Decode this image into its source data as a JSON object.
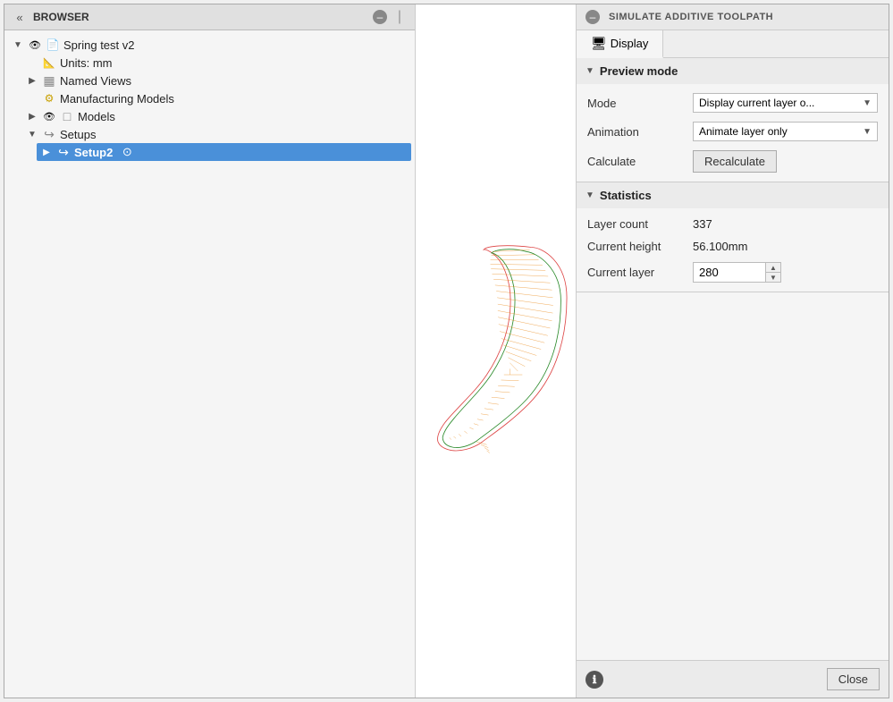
{
  "browser": {
    "title": "BROWSER",
    "header_icons": [
      "«",
      "–",
      "|"
    ],
    "tree": {
      "root": {
        "label": "Spring test v2",
        "icon": "doc",
        "expanded": true
      },
      "units": {
        "label": "Units: mm",
        "icon": "unit"
      },
      "named_views": {
        "label": "Named Views",
        "icon": "views",
        "expanded": false
      },
      "manufacturing_models": {
        "label": "Manufacturing Models",
        "icon": "mfg"
      },
      "models": {
        "label": "Models",
        "icon": "models",
        "expanded": false
      },
      "setups": {
        "label": "Setups",
        "icon": "setups",
        "expanded": true
      },
      "setup2": {
        "label": "Setup2",
        "icon": "setup2",
        "selected": true,
        "expanded": false
      }
    }
  },
  "panel": {
    "title": "SIMULATE ADDITIVE TOOLPATH",
    "tabs": [
      {
        "label": "Display",
        "active": true
      }
    ],
    "preview_mode": {
      "section_title": "Preview mode",
      "mode_label": "Mode",
      "mode_value": "Display current layer o...",
      "animation_label": "Animation",
      "animation_value": "Animate layer only",
      "calculate_label": "Calculate",
      "calculate_btn": "Recalculate"
    },
    "statistics": {
      "section_title": "Statistics",
      "layer_count_label": "Layer count",
      "layer_count_value": "337",
      "current_height_label": "Current height",
      "current_height_value": "56.100mm",
      "current_layer_label": "Current layer",
      "current_layer_value": "280"
    },
    "footer": {
      "close_btn": "Close"
    }
  }
}
